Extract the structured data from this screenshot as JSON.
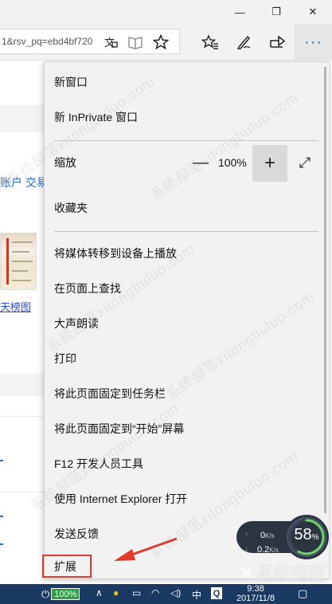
{
  "titlebar": {
    "minimize_glyph": "—",
    "maximize_glyph": "❐",
    "close_glyph": "✕"
  },
  "toolbar": {
    "url": "1&rsv_pq=ebd4bf720",
    "icons": [
      "translate-icon",
      "reading-view-icon",
      "favorite-star-icon",
      "hub-icon",
      "web-note-pen-icon",
      "share-icon",
      "more-icon"
    ],
    "more_glyph": "···"
  },
  "page": {
    "nav_text": "账户 交易",
    "link_text": "天榜图"
  },
  "menu": {
    "items": [
      {
        "label": "新窗口"
      },
      {
        "label": "新 InPrivate 窗口"
      },
      {
        "label": "缩放"
      },
      {
        "label": "收藏夹"
      },
      {
        "label": "将媒体转移到设备上播放"
      },
      {
        "label": "在页面上查找"
      },
      {
        "label": "大声朗读"
      },
      {
        "label": "打印"
      },
      {
        "label": "将此页面固定到任务栏"
      },
      {
        "label": "将此页面固定到“开始”屏幕"
      },
      {
        "label": "F12 开发人员工具"
      },
      {
        "label": "使用 Internet Explorer 打开"
      },
      {
        "label": "发送反馈"
      },
      {
        "label": "扩展"
      }
    ],
    "zoom": {
      "value": "100%",
      "minus_glyph": "—",
      "plus_glyph": "+",
      "fullscreen_glyph": "⤢"
    }
  },
  "annotation": {
    "color": "#e03a2c"
  },
  "speed_widget": {
    "upload": "0",
    "upload_unit": "K/s",
    "download": "0.2",
    "download_unit": "K/s",
    "percent": "58",
    "percent_sign": "%",
    "fraction": 0.58
  },
  "taskbar": {
    "battery": "100%",
    "ime": "中",
    "app_q": "Q",
    "time": "9:38",
    "date": "2017/11/8"
  },
  "watermark": {
    "text": "系统部落xitongbuluo.com",
    "brand": "系统部落"
  },
  "colors": {
    "accent": "#1a73c8",
    "menu_bg": "#f2f2f2",
    "taskbar": "#1b3a63",
    "battery": "#2f9e44",
    "highlight": "#e03a2c"
  }
}
